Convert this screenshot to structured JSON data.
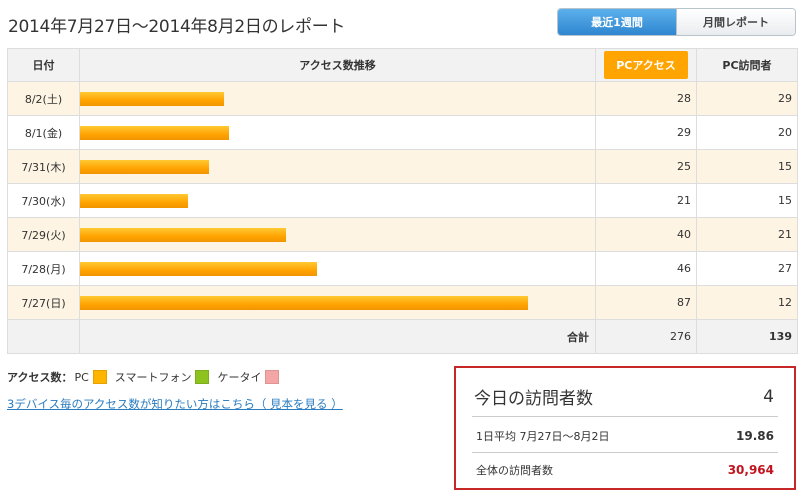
{
  "title": "2014年7月27日〜2014年8月2日のレポート",
  "period_buttons": {
    "recent_week": "最近1週間",
    "monthly_report": "月間レポート"
  },
  "table": {
    "headers": {
      "date": "日付",
      "trend": "アクセス数推移",
      "pc_access": "PCアクセス",
      "pc_visitors": "PC訪問者"
    },
    "rows": [
      {
        "date": "8/2(土)",
        "access": 28,
        "visitors": 29
      },
      {
        "date": "8/1(金)",
        "access": 29,
        "visitors": 20
      },
      {
        "date": "7/31(木)",
        "access": 25,
        "visitors": 15
      },
      {
        "date": "7/30(水)",
        "access": 21,
        "visitors": 15
      },
      {
        "date": "7/29(火)",
        "access": 40,
        "visitors": 21
      },
      {
        "date": "7/28(月)",
        "access": 46,
        "visitors": 27
      },
      {
        "date": "7/27(日)",
        "access": 87,
        "visitors": 12
      }
    ],
    "total": {
      "label": "合計",
      "access": "276",
      "visitors": "139"
    }
  },
  "legend": {
    "title": "アクセス数：",
    "items": [
      {
        "label": "PC",
        "color": "#ffb400"
      },
      {
        "label": "スマートフォン",
        "color": "#8dc21f"
      },
      {
        "label": "ケータイ",
        "color": "#f4a6a6"
      }
    ]
  },
  "device_link": "3デバイス毎のアクセス数が知りたい方はこちら（ 見本を見る ）",
  "today": {
    "label": "今日の訪問者数",
    "value": "4",
    "avg_label": "1日平均 7月27日〜8月2日",
    "avg_value": "19.86",
    "total_label": "全体の訪問者数",
    "total_value": "30,964"
  }
}
